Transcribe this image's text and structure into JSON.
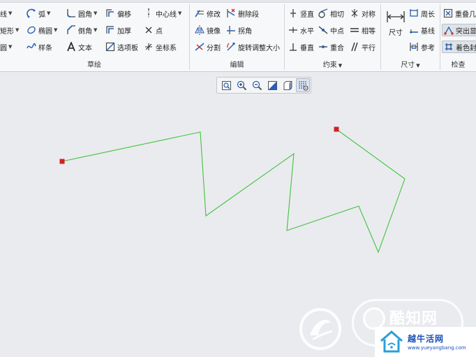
{
  "ribbon": {
    "sketch": {
      "label": "草绘",
      "tools": {
        "line": "线",
        "rectangle": "矩形",
        "circle": "圆",
        "arc": "弧",
        "ellipse": "椭圆",
        "spline": "样条",
        "fillet": "圆角",
        "chamfer": "倒角",
        "text": "文本",
        "offset": "偏移",
        "thicken": "加厚",
        "palette": "选项板",
        "centerline": "中心线",
        "point": "点",
        "coordsys": "坐标系"
      }
    },
    "edit": {
      "label": "编辑",
      "tools": {
        "modify": "修改",
        "delete_segment": "删除段",
        "mirror": "镜像",
        "corner": "拐角",
        "divide": "分割",
        "rotate_resize": "旋转调整大小"
      }
    },
    "constrain": {
      "label": "约束",
      "tools": {
        "vertical": "竖直",
        "tangent": "相切",
        "symmetric": "对称",
        "horizontal": "水平",
        "midpoint": "中点",
        "equal": "相等",
        "perpendicular": "垂直",
        "coincident": "重合",
        "parallel": "平行"
      }
    },
    "dimension": {
      "label": "尺寸",
      "tools": {
        "dimension": "尺寸",
        "perimeter": "周长",
        "baseline": "基线",
        "reference": "参考"
      }
    },
    "inspect": {
      "label": "检查",
      "tools": {
        "overlap": "重叠几",
        "highlight": "突出显",
        "shade": "着色封"
      }
    }
  },
  "view_toolbar": {
    "icons": [
      "refit-icon",
      "zoom-in-icon",
      "zoom-out-icon",
      "repaint-icon",
      "display-style-icon",
      "sketch-display-filter-icon"
    ]
  },
  "watermarks": {
    "brand_a": "酷知网",
    "brand_b": "越牛活网",
    "brand_b_url": "www.yueyangbang.com"
  },
  "colors": {
    "sketch_line": "#3fc23f",
    "endpoint": "#d42020",
    "icon_blue": "#2b5fb3"
  }
}
